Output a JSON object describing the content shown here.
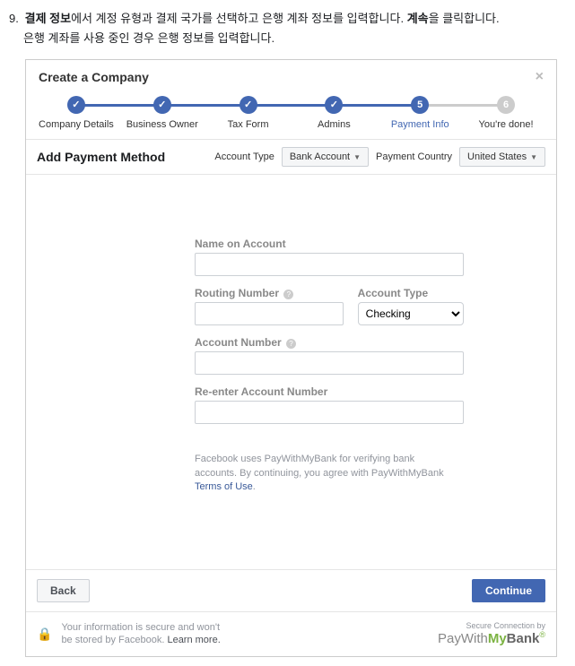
{
  "doc": {
    "step_num": "9.",
    "line1_b1": "결제 정보",
    "line1_mid": "에서 계정 유형과 결제 국가를 선택하고 은행 계좌 정보를 입력합니다. ",
    "line1_b2": "계속",
    "line1_end": "을 클릭합니다.",
    "line2": "은행 계좌를 사용 중인 경우 은행 정보를 입력합니다."
  },
  "panel": {
    "title": "Create a Company"
  },
  "steps": [
    {
      "label": "Company Details",
      "state": "done"
    },
    {
      "label": "Business Owner",
      "state": "done"
    },
    {
      "label": "Tax Form",
      "state": "done"
    },
    {
      "label": "Admins",
      "state": "done"
    },
    {
      "label": "Payment Info",
      "state": "current",
      "num": "5"
    },
    {
      "label": "You're done!",
      "state": "inactive",
      "num": "6"
    }
  ],
  "method": {
    "title": "Add Payment Method",
    "acct_type_label": "Account Type",
    "acct_type_value": "Bank Account",
    "country_label": "Payment Country",
    "country_value": "United States"
  },
  "form": {
    "name_label": "Name on Account",
    "routing_label": "Routing Number",
    "acct_type2_label": "Account Type",
    "acct_type2_value": "Checking",
    "acct_num_label": "Account Number",
    "reenter_label": "Re-enter Account Number",
    "disclaimer_a": "Facebook uses PayWithMyBank for verifying bank accounts. By continuing, you agree with PayWithMyBank ",
    "disclaimer_link": "Terms of Use",
    "disclaimer_end": "."
  },
  "buttons": {
    "back": "Back",
    "cont": "Continue"
  },
  "secure": {
    "line1": "Your information is secure and won't",
    "line2a": "be stored by Facebook. ",
    "learn": "Learn more.",
    "conn": "Secure Connection by"
  }
}
